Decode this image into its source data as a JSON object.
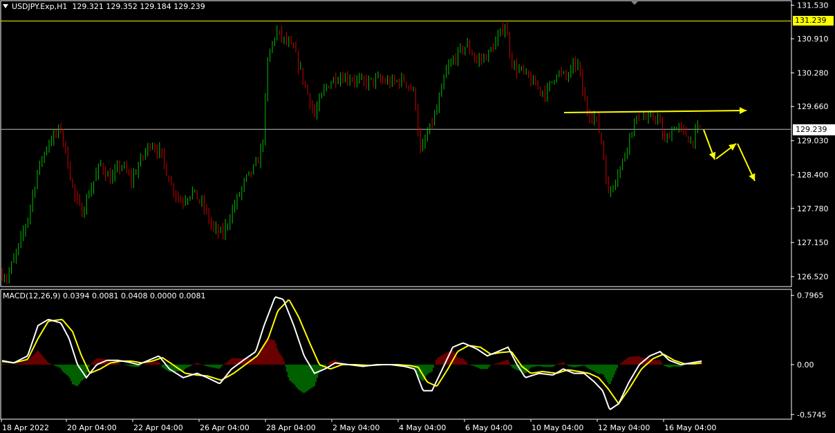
{
  "header": {
    "symbol": "USDJPY.Exp,H1",
    "ohlc": "129.321 129.352 129.184 129.239"
  },
  "macd_header": {
    "text": "MACD(12,26,9) 0.0394 0.0081 0.0408 0.0000 0.0081"
  },
  "price_tags": {
    "last_high": "131.239",
    "current": "129.239"
  },
  "colors": {
    "background": "#000000",
    "bull": "#00c000",
    "bear": "#d00000",
    "grid": "#ffffff",
    "signal": "#ffff00",
    "macd_line": "#ffffff",
    "annotation": "#ffff00"
  },
  "chart_data": [
    {
      "type": "candlestick",
      "title": "USDJPY.Exp,H1",
      "y_ticks": [
        "131.530",
        "130.910",
        "130.280",
        "129.660",
        "129.030",
        "128.400",
        "127.780",
        "127.150",
        "126.520"
      ],
      "ylim": [
        126.35,
        131.6
      ],
      "x_ticks": [
        "18 Apr 2022",
        "20 Apr 04:00",
        "22 Apr 04:00",
        "26 Apr 04:00",
        "28 Apr 04:00",
        "2 May 04:00",
        "4 May 04:00",
        "6 May 04:00",
        "10 May 04:00",
        "12 May 04:00",
        "16 May 04:00"
      ],
      "bars": 300,
      "close_path": [
        [
          0,
          126.6
        ],
        [
          10,
          126.5
        ],
        [
          25,
          127.0
        ],
        [
          40,
          127.6
        ],
        [
          55,
          128.5
        ],
        [
          70,
          129.0
        ],
        [
          88,
          129.25
        ],
        [
          95,
          128.8
        ],
        [
          108,
          128.0
        ],
        [
          118,
          127.7
        ],
        [
          130,
          128.1
        ],
        [
          145,
          128.6
        ],
        [
          160,
          128.3
        ],
        [
          175,
          128.6
        ],
        [
          190,
          128.3
        ],
        [
          205,
          128.7
        ],
        [
          218,
          129.0
        ],
        [
          232,
          128.8
        ],
        [
          248,
          128.2
        ],
        [
          262,
          127.9
        ],
        [
          278,
          128.1
        ],
        [
          295,
          127.8
        ],
        [
          308,
          127.4
        ],
        [
          322,
          127.3
        ],
        [
          338,
          127.8
        ],
        [
          355,
          128.3
        ],
        [
          372,
          128.6
        ],
        [
          380,
          129.0
        ],
        [
          388,
          130.6
        ],
        [
          400,
          131.05
        ],
        [
          410,
          130.9
        ],
        [
          425,
          130.7
        ],
        [
          440,
          130.1
        ],
        [
          455,
          129.5
        ],
        [
          470,
          130.0
        ],
        [
          485,
          130.2
        ],
        [
          505,
          130.2
        ],
        [
          525,
          130.1
        ],
        [
          545,
          130.15
        ],
        [
          565,
          130.1
        ],
        [
          585,
          130.15
        ],
        [
          600,
          129.9
        ],
        [
          608,
          128.8
        ],
        [
          620,
          129.2
        ],
        [
          632,
          129.6
        ],
        [
          645,
          130.3
        ],
        [
          660,
          130.6
        ],
        [
          675,
          130.8
        ],
        [
          690,
          130.5
        ],
        [
          705,
          130.6
        ],
        [
          720,
          130.9
        ],
        [
          730,
          131.2
        ],
        [
          742,
          130.4
        ],
        [
          756,
          130.3
        ],
        [
          770,
          130.1
        ],
        [
          790,
          129.9
        ],
        [
          805,
          130.3
        ],
        [
          820,
          130.2
        ],
        [
          835,
          130.5
        ],
        [
          848,
          129.6
        ],
        [
          862,
          129.45
        ],
        [
          872,
          128.9
        ],
        [
          880,
          128.0
        ],
        [
          888,
          128.3
        ],
        [
          900,
          128.6
        ],
        [
          912,
          129.2
        ],
        [
          925,
          129.5
        ],
        [
          938,
          129.4
        ],
        [
          950,
          129.5
        ],
        [
          962,
          129.0
        ],
        [
          975,
          129.3
        ],
        [
          988,
          129.2
        ],
        [
          1000,
          129.0
        ],
        [
          1012,
          129.3
        ],
        [
          1018,
          129.24
        ]
      ],
      "annotations": [
        "horizontal resistance arrow",
        "projected zigzag arrows down"
      ]
    },
    {
      "type": "macd",
      "title": "MACD(12,26,9)",
      "params": [
        12,
        26,
        9
      ],
      "values": {
        "macd": 0.0394,
        "signal": 0.0081,
        "histogram": 0.0408
      },
      "y_ticks": [
        "0.7965",
        "0.00",
        "-0.5745"
      ],
      "ylim": [
        -0.62,
        0.85
      ],
      "macd_path": [
        [
          0,
          0.05
        ],
        [
          20,
          0.02
        ],
        [
          40,
          0.1
        ],
        [
          55,
          0.45
        ],
        [
          70,
          0.52
        ],
        [
          88,
          0.48
        ],
        [
          100,
          0.3
        ],
        [
          112,
          0.0
        ],
        [
          125,
          -0.15
        ],
        [
          140,
          0.0
        ],
        [
          155,
          0.05
        ],
        [
          170,
          0.05
        ],
        [
          185,
          0.03
        ],
        [
          200,
          0.0
        ],
        [
          215,
          0.05
        ],
        [
          230,
          0.1
        ],
        [
          245,
          -0.05
        ],
        [
          265,
          -0.15
        ],
        [
          285,
          -0.1
        ],
        [
          300,
          -0.15
        ],
        [
          318,
          -0.22
        ],
        [
          335,
          -0.05
        ],
        [
          352,
          0.05
        ],
        [
          370,
          0.15
        ],
        [
          382,
          0.45
        ],
        [
          398,
          0.78
        ],
        [
          410,
          0.75
        ],
        [
          425,
          0.45
        ],
        [
          440,
          0.1
        ],
        [
          455,
          -0.1
        ],
        [
          470,
          -0.05
        ],
        [
          485,
          0.02
        ],
        [
          505,
          0.0
        ],
        [
          525,
          -0.02
        ],
        [
          545,
          0.0
        ],
        [
          565,
          0.0
        ],
        [
          585,
          -0.02
        ],
        [
          600,
          -0.05
        ],
        [
          612,
          -0.3
        ],
        [
          625,
          -0.3
        ],
        [
          640,
          -0.05
        ],
        [
          655,
          0.2
        ],
        [
          670,
          0.25
        ],
        [
          690,
          0.18
        ],
        [
          705,
          0.1
        ],
        [
          720,
          0.15
        ],
        [
          735,
          0.2
        ],
        [
          748,
          0.0
        ],
        [
          760,
          -0.15
        ],
        [
          780,
          -0.1
        ],
        [
          800,
          -0.12
        ],
        [
          815,
          -0.05
        ],
        [
          830,
          -0.1
        ],
        [
          845,
          -0.1
        ],
        [
          860,
          -0.2
        ],
        [
          872,
          -0.3
        ],
        [
          882,
          -0.52
        ],
        [
          895,
          -0.45
        ],
        [
          910,
          -0.2
        ],
        [
          925,
          0.0
        ],
        [
          940,
          0.1
        ],
        [
          955,
          0.15
        ],
        [
          968,
          0.05
        ],
        [
          985,
          0.0
        ],
        [
          1000,
          0.02
        ],
        [
          1015,
          0.04
        ]
      ],
      "signal_path": [
        [
          0,
          0.04
        ],
        [
          20,
          0.02
        ],
        [
          40,
          0.06
        ],
        [
          55,
          0.3
        ],
        [
          70,
          0.5
        ],
        [
          90,
          0.52
        ],
        [
          105,
          0.38
        ],
        [
          118,
          0.1
        ],
        [
          130,
          -0.1
        ],
        [
          145,
          -0.05
        ],
        [
          160,
          0.02
        ],
        [
          175,
          0.04
        ],
        [
          190,
          0.04
        ],
        [
          205,
          0.02
        ],
        [
          220,
          0.04
        ],
        [
          235,
          0.08
        ],
        [
          250,
          0.0
        ],
        [
          268,
          -0.1
        ],
        [
          285,
          -0.12
        ],
        [
          300,
          -0.13
        ],
        [
          320,
          -0.18
        ],
        [
          338,
          -0.1
        ],
        [
          355,
          0.0
        ],
        [
          372,
          0.1
        ],
        [
          388,
          0.3
        ],
        [
          402,
          0.62
        ],
        [
          418,
          0.75
        ],
        [
          432,
          0.55
        ],
        [
          448,
          0.25
        ],
        [
          462,
          0.0
        ],
        [
          478,
          -0.05
        ],
        [
          495,
          0.0
        ],
        [
          515,
          0.0
        ],
        [
          535,
          -0.01
        ],
        [
          555,
          0.0
        ],
        [
          575,
          0.0
        ],
        [
          592,
          -0.01
        ],
        [
          605,
          -0.03
        ],
        [
          618,
          -0.2
        ],
        [
          632,
          -0.25
        ],
        [
          648,
          -0.05
        ],
        [
          662,
          0.15
        ],
        [
          678,
          0.22
        ],
        [
          695,
          0.2
        ],
        [
          710,
          0.12
        ],
        [
          725,
          0.14
        ],
        [
          740,
          0.15
        ],
        [
          755,
          -0.02
        ],
        [
          768,
          -0.1
        ],
        [
          785,
          -0.08
        ],
        [
          805,
          -0.1
        ],
        [
          822,
          -0.06
        ],
        [
          838,
          -0.08
        ],
        [
          852,
          -0.1
        ],
        [
          866,
          -0.15
        ],
        [
          880,
          -0.28
        ],
        [
          895,
          -0.45
        ],
        [
          910,
          -0.28
        ],
        [
          928,
          -0.05
        ],
        [
          945,
          0.07
        ],
        [
          960,
          0.12
        ],
        [
          975,
          0.05
        ],
        [
          990,
          0.01
        ],
        [
          1005,
          0.01
        ],
        [
          1015,
          0.02
        ]
      ]
    }
  ]
}
